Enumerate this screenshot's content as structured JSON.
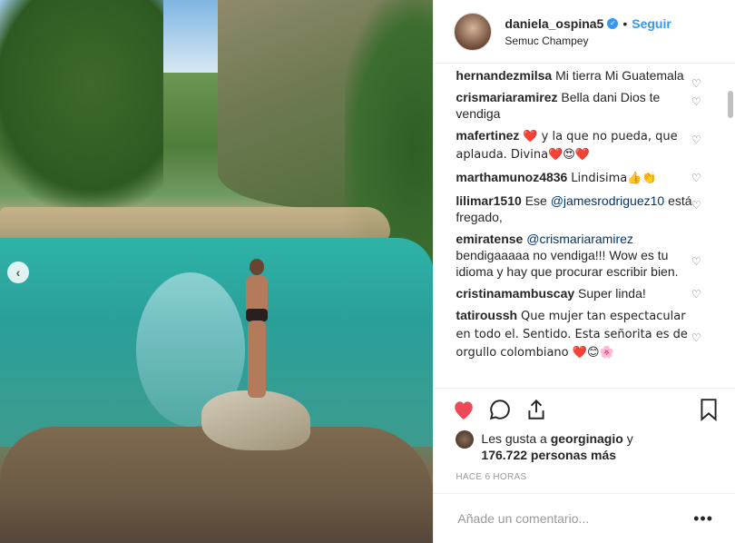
{
  "post": {
    "username": "daniela_ospina5",
    "verified": true,
    "follow_label": "Seguir",
    "separator": "•",
    "location": "Semuc Champey"
  },
  "comments": [
    {
      "user": "hernandezmilsa",
      "text": "Mi tierra Mi Guatemala"
    },
    {
      "user": "crismariaramirez",
      "text": "Bella dani Dios te vendiga"
    },
    {
      "user": "mafertinez",
      "text": "❤️ y la que no pueda, que aplauda. Divina❤️😍❤️"
    },
    {
      "user": "marthamunoz4836",
      "text": "Lindisima👍👏"
    },
    {
      "user": "lilimar1510",
      "text_before": "Ese ",
      "mention": "@jamesrodriguez10",
      "text_after": " está fregado,"
    },
    {
      "user": "emiratense",
      "mention": "@crismariaramirez",
      "text_after": " bendigaaaaa no vendiga!!! Wow es tu idioma y hay que procurar escribir bien."
    },
    {
      "user": "cristinamambuscay",
      "text": "Super linda!"
    },
    {
      "user": "tatiroussh",
      "text": "Que mujer tan espectacular en todo el. Sentido. Esta señorita es de orgullo colombiano ❤️😊🌸"
    }
  ],
  "likes": {
    "prefix": "Les gusta a ",
    "user": "georginagio",
    "conjunction": " y",
    "count": "176.722 personas más"
  },
  "time_ago": "HACE 6 HORAS",
  "add_comment": {
    "placeholder": "Añade un comentario..."
  },
  "more_label": "•••",
  "nav_prev_glyph": "‹",
  "icons": [
    "heart-icon",
    "comment-icon",
    "share-icon",
    "bookmark-icon",
    "heart-outline-icon"
  ],
  "colors": {
    "link": "#3897f0",
    "like": "#ed4956",
    "mention": "#003569"
  }
}
